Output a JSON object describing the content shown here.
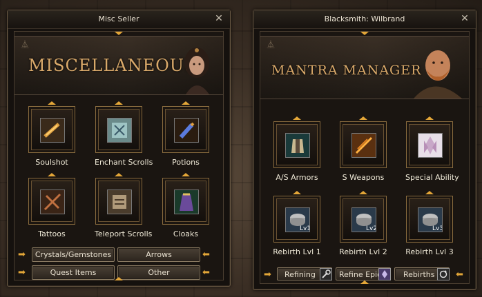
{
  "windows": {
    "left": {
      "title": "Misc Seller",
      "banner": "MISCELLANEOUS",
      "slots": [
        {
          "label": "Soulshot",
          "icon": "soulshot-icon"
        },
        {
          "label": "Enchant Scrolls",
          "icon": "enchant-scroll-icon"
        },
        {
          "label": "Potions",
          "icon": "potion-icon"
        },
        {
          "label": "Tattoos",
          "icon": "tattoo-icon"
        },
        {
          "label": "Teleport Scrolls",
          "icon": "teleport-scroll-icon"
        },
        {
          "label": "Cloaks",
          "icon": "cloak-icon"
        }
      ],
      "buttons": [
        "Crystals/Gemstones",
        "Arrows",
        "Quest Items",
        "Other"
      ]
    },
    "right": {
      "title": "Blacksmith: Wilbrand",
      "banner": "MANTRA MANAGER",
      "slots": [
        {
          "label": "A/S Armors",
          "icon": "armor-icon"
        },
        {
          "label": "S Weapons",
          "icon": "weapon-icon"
        },
        {
          "label": "Special Ability",
          "icon": "crystal-icon"
        },
        {
          "label": "Rebirth Lvl 1",
          "icon": "rebirth-lvl1-icon",
          "badge": "Lv1"
        },
        {
          "label": "Rebirth Lvl 2",
          "icon": "rebirth-lvl2-icon",
          "badge": "Lv2"
        },
        {
          "label": "Rebirth Lvl 3",
          "icon": "rebirth-lvl3-icon",
          "badge": "Lv3"
        }
      ],
      "buttons": [
        "Refining",
        "Refine Epic",
        "Rebirths"
      ]
    }
  },
  "close_glyph": "✕",
  "colors": {
    "accent": "#e3a638",
    "banner_text": "#d9a96a",
    "label": "#f0ead8"
  }
}
